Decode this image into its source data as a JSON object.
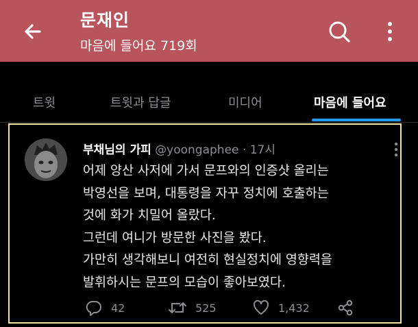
{
  "header": {
    "title": "문재인",
    "subtitle": "마음에 들어요 719회"
  },
  "tabs": [
    {
      "label": "트윗"
    },
    {
      "label": "트윗과 답글"
    },
    {
      "label": "미디어"
    },
    {
      "label": "마음에 들어요"
    }
  ],
  "tweet": {
    "author_name": "부채님의 가피",
    "handle": "@yoongaphee",
    "separator": "·",
    "time": "17시",
    "lines": [
      "어제 양산 사저에 가서 문프와의 인증샷 올리는",
      "박영선을 보며, 대통령을 자꾸 정치에 호출하는",
      "것에 화가 치밀어 올랐다.",
      "그런데 여니가 방문한 사진을 봤다.",
      "가만히 생각해보니 여전히 현실정치에 영향력을",
      "발휘하시는 문프의 모습이 좋아보였다."
    ],
    "replies": "42",
    "retweets": "525",
    "likes": "1,432"
  },
  "icons": [
    "back-arrow-icon",
    "search-icon",
    "more-vertical-icon",
    "reply-icon",
    "retweet-icon",
    "like-icon",
    "share-icon"
  ],
  "colors": {
    "header_bg": "#b8545b",
    "accent": "#1d9bf0",
    "highlight_border": "#f1e5a0"
  }
}
